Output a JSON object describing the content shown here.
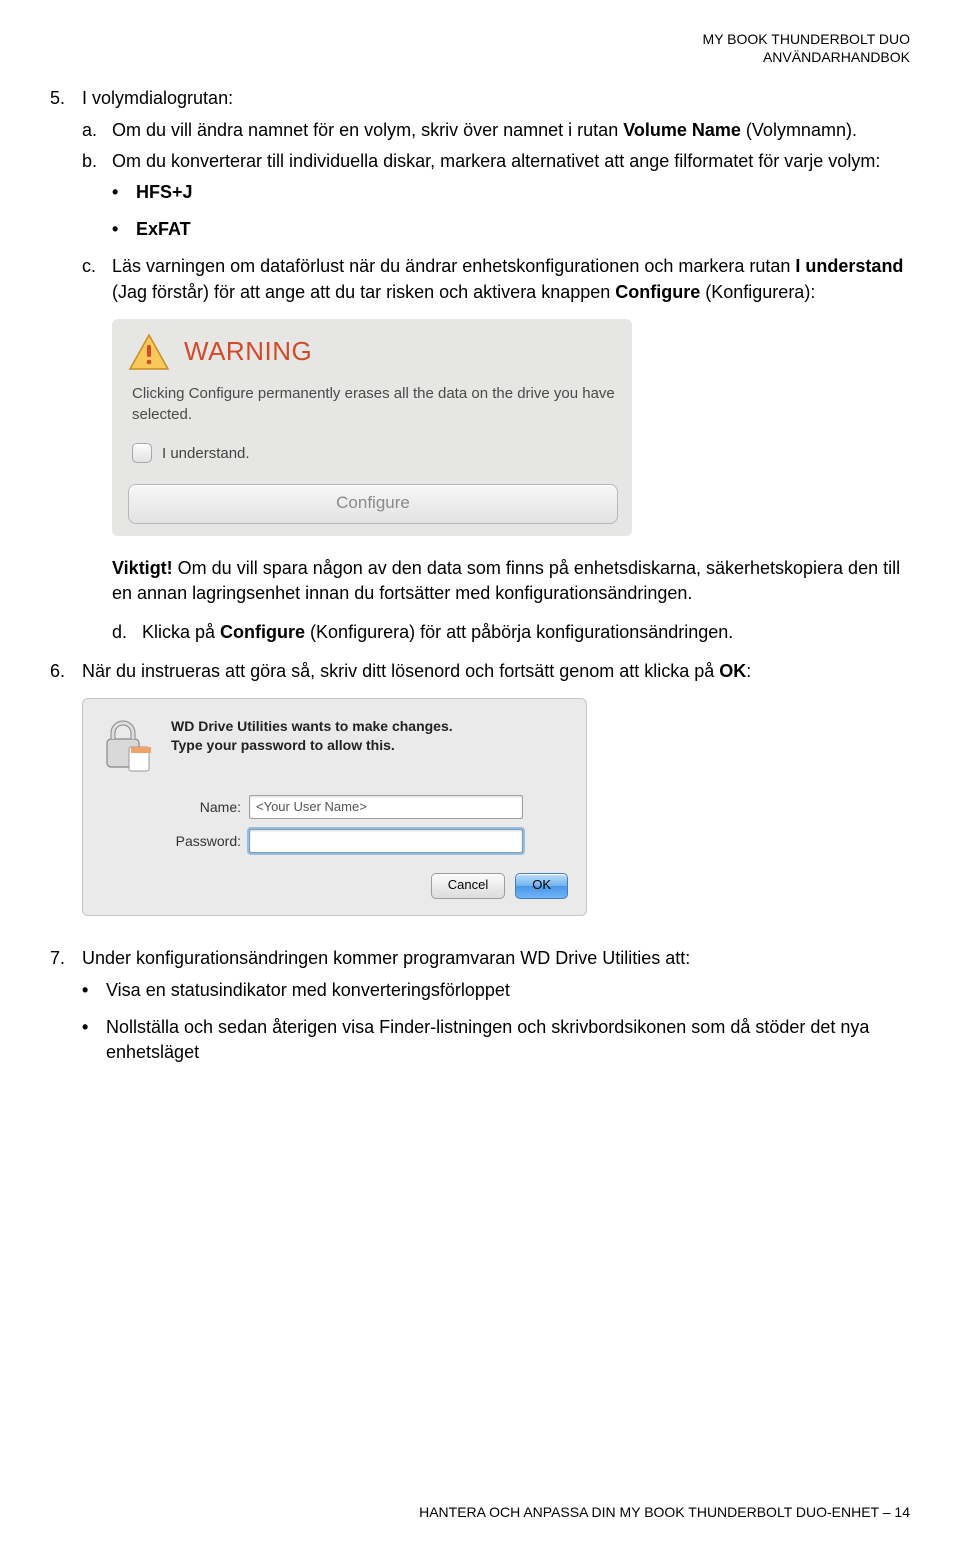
{
  "header": {
    "line1": "MY BOOK THUNDERBOLT DUO",
    "line2": "ANVÄNDARHANDBOK"
  },
  "step5": {
    "number": "5.",
    "text": "I volymdialogrutan:",
    "a": {
      "mark": "a.",
      "text_before": "Om du vill ändra namnet för en volym, skriv över namnet i rutan ",
      "bold": "Volume Name",
      "text_after": " (Volymnamn)."
    },
    "b": {
      "mark": "b.",
      "text": "Om du konverterar till individuella diskar, markera alternativet att ange filformatet för varje volym:",
      "bullet1": "HFS+J",
      "bullet2": "ExFAT"
    },
    "c": {
      "mark": "c.",
      "seg1": "Läs varningen om dataförlust när du ändrar enhetskonfigurationen och markera rutan ",
      "bold1": "I understand",
      "seg2": " (Jag förstår) för att ange att du tar risken och aktivera knappen ",
      "bold2": "Configure",
      "seg3": " (Konfigurera):"
    },
    "important": {
      "label": "Viktigt!",
      "text": " Om du vill spara någon av den data som finns på enhetsdiskarna, säkerhetskopiera den till en annan lagringsenhet innan du fortsätter med konfigurationsändringen."
    },
    "d": {
      "mark": "d.",
      "seg1": "Klicka på ",
      "bold": "Configure",
      "seg2": " (Konfigurera) för att påbörja konfigurationsändringen."
    }
  },
  "warning_box": {
    "title": "WARNING",
    "text": "Clicking Configure permanently erases all the data on the drive you have selected.",
    "checkbox_label": "I understand.",
    "button": "Configure"
  },
  "step6": {
    "number": "6.",
    "seg1": "När du instrueras att göra så, skriv ditt lösenord och fortsätt genom att klicka på ",
    "bold": "OK",
    "seg2": ":"
  },
  "password_dialog": {
    "line1": "WD Drive Utilities wants to make changes.",
    "line2": "Type your password to allow this.",
    "name_label": "Name:",
    "name_value": "<Your User Name>",
    "password_label": "Password:",
    "password_value": "",
    "cancel": "Cancel",
    "ok": "OK"
  },
  "step7": {
    "number": "7.",
    "text": "Under konfigurationsändringen kommer programvaran WD Drive Utilities att:",
    "bullet1": "Visa en statusindikator med konverteringsförloppet",
    "bullet2": "Nollställa och sedan återigen visa Finder-listningen och skrivbordsikonen som då stöder det nya enhetsläget"
  },
  "footer": {
    "text": "HANTERA OCH ANPASSA DIN MY BOOK THUNDERBOLT DUO-ENHET – 14"
  }
}
